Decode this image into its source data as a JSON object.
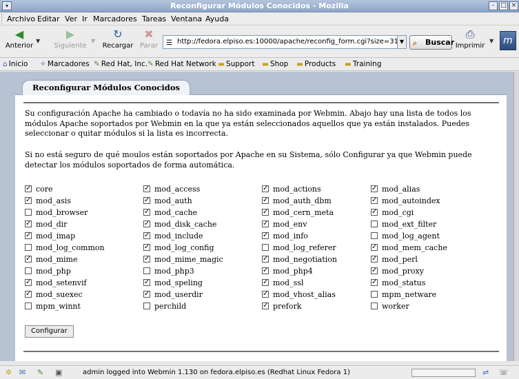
{
  "window": {
    "title": "Reconfigurar Módulos Conocidos - Mozilla"
  },
  "menu": [
    "Archivo",
    "Editar",
    "Ver",
    "Ir",
    "Marcadores",
    "Tareas",
    "Ventana",
    "Ayuda"
  ],
  "toolbar": {
    "back": "Anterior",
    "forward": "Siguiente",
    "reload": "Recargar",
    "stop": "Parar",
    "url": "http://fedora.elpiso.es:10000/apache/reconfig_form.cgi?size=310420",
    "search": "Buscar",
    "print": "Imprimir"
  },
  "bookmarks": [
    "Inicio",
    "Marcadores",
    "Red Hat, Inc.",
    "Red Hat Network",
    "Support",
    "Shop",
    "Products",
    "Training"
  ],
  "page": {
    "tab": "Reconfigurar Módulos Conocidos",
    "para1": "Su configuración Apache ha cambiado o todavía no ha sido examinada por Webmin. Abajo hay una lista de todos los módulos Apache soportados por Webmin en la que ya están seleccionados aquellos que ya están instalados. Puedes seleccionar o quitar módulos si la lista es incorrecta.",
    "para2": "Si no está seguro de qué moulos están soportados por Apache en su Sistema, sólo Configurar ya que Webmin puede detectar los módulos soportados de forma automática.",
    "button": "Configurar"
  },
  "modules": [
    {
      "name": "core",
      "checked": true
    },
    {
      "name": "mod_access",
      "checked": true
    },
    {
      "name": "mod_actions",
      "checked": true
    },
    {
      "name": "mod_alias",
      "checked": true
    },
    {
      "name": "mod_asis",
      "checked": true
    },
    {
      "name": "mod_auth",
      "checked": true
    },
    {
      "name": "mod_auth_dbm",
      "checked": true
    },
    {
      "name": "mod_autoindex",
      "checked": true
    },
    {
      "name": "mod_browser",
      "checked": false
    },
    {
      "name": "mod_cache",
      "checked": true
    },
    {
      "name": "mod_cern_meta",
      "checked": true
    },
    {
      "name": "mod_cgi",
      "checked": true
    },
    {
      "name": "mod_dir",
      "checked": true
    },
    {
      "name": "mod_disk_cache",
      "checked": true
    },
    {
      "name": "mod_env",
      "checked": true
    },
    {
      "name": "mod_ext_filter",
      "checked": false
    },
    {
      "name": "mod_imap",
      "checked": true
    },
    {
      "name": "mod_include",
      "checked": true
    },
    {
      "name": "mod_info",
      "checked": true
    },
    {
      "name": "mod_log_agent",
      "checked": false
    },
    {
      "name": "mod_log_common",
      "checked": false
    },
    {
      "name": "mod_log_config",
      "checked": true
    },
    {
      "name": "mod_log_referer",
      "checked": false
    },
    {
      "name": "mod_mem_cache",
      "checked": true
    },
    {
      "name": "mod_mime",
      "checked": true
    },
    {
      "name": "mod_mime_magic",
      "checked": true
    },
    {
      "name": "mod_negotiation",
      "checked": true
    },
    {
      "name": "mod_perl",
      "checked": true
    },
    {
      "name": "mod_php",
      "checked": false
    },
    {
      "name": "mod_php3",
      "checked": false
    },
    {
      "name": "mod_php4",
      "checked": true
    },
    {
      "name": "mod_proxy",
      "checked": true
    },
    {
      "name": "mod_setenvif",
      "checked": true
    },
    {
      "name": "mod_speling",
      "checked": true
    },
    {
      "name": "mod_ssl",
      "checked": true
    },
    {
      "name": "mod_status",
      "checked": true
    },
    {
      "name": "mod_suexec",
      "checked": true
    },
    {
      "name": "mod_userdir",
      "checked": true
    },
    {
      "name": "mod_vhost_alias",
      "checked": true
    },
    {
      "name": "mpm_netware",
      "checked": false
    },
    {
      "name": "mpm_winnt",
      "checked": false
    },
    {
      "name": "perchild",
      "checked": false
    },
    {
      "name": "prefork",
      "checked": true
    },
    {
      "name": "worker",
      "checked": false
    }
  ],
  "status": {
    "text": "admin logged into Webmin 1.130 on fedora.elpiso.es (Redhat Linux Fedora 1)"
  }
}
